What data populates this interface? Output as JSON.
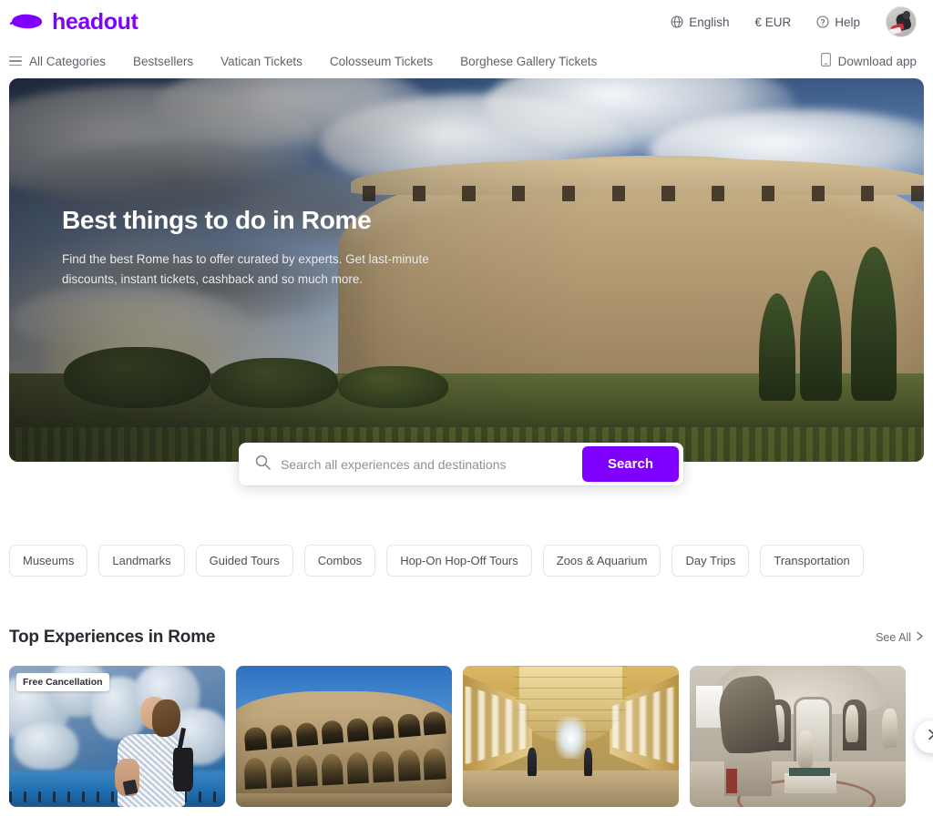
{
  "brand": {
    "name": "headout",
    "logo_icon": "headout-logo-icon",
    "accent_color": "#8000ff"
  },
  "header": {
    "language": {
      "label": "English",
      "icon": "globe-icon"
    },
    "currency": {
      "label": "€ EUR",
      "icon": "currency-euro"
    },
    "help": {
      "label": "Help",
      "icon": "help-circle-icon"
    },
    "avatar": {
      "icon": "user-avatar",
      "alt": "Account avatar"
    }
  },
  "nav": {
    "all_categories": {
      "label": "All Categories",
      "icon": "hamburger-icon"
    },
    "items": [
      {
        "label": "Bestsellers"
      },
      {
        "label": "Vatican Tickets"
      },
      {
        "label": "Colosseum Tickets"
      },
      {
        "label": "Borghese Gallery Tickets"
      }
    ],
    "download_app": {
      "label": "Download app",
      "icon": "mobile-phone-icon"
    }
  },
  "hero": {
    "title": "Best things to do in Rome",
    "subtitle": "Find the best Rome has to offer curated by experts. Get last-minute discounts, instant tickets, cashback and so much more.",
    "image_alt": "Colosseum at sunrise"
  },
  "search": {
    "icon": "search-icon",
    "placeholder": "Search all experiences and destinations",
    "value": "",
    "button_label": "Search"
  },
  "chips": [
    {
      "label": "Museums"
    },
    {
      "label": "Landmarks"
    },
    {
      "label": "Guided Tours"
    },
    {
      "label": "Combos"
    },
    {
      "label": "Hop-On Hop-Off Tours"
    },
    {
      "label": "Zoos & Aquarium"
    },
    {
      "label": "Day Trips"
    },
    {
      "label": "Transportation"
    }
  ],
  "top_experiences": {
    "title": "Top Experiences in Rome",
    "see_all": {
      "label": "See All",
      "icon": "chevron-right-icon"
    },
    "next_button": {
      "icon": "chevron-right-icon"
    },
    "cards": [
      {
        "badge": "Free Cancellation",
        "image_alt": "Woman at the Trevi Fountain"
      },
      {
        "badge": "",
        "image_alt": "Colosseum exterior under blue sky"
      },
      {
        "badge": "",
        "image_alt": "Vatican Museums sculpture corridor"
      },
      {
        "badge": "",
        "image_alt": "Borghese Gallery statue hall"
      }
    ]
  }
}
